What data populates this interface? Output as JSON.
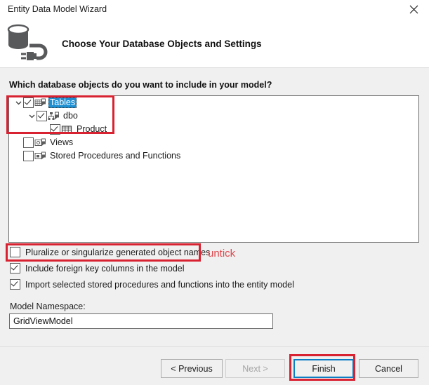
{
  "window": {
    "title": "Entity Data Model Wizard",
    "close_icon": "close-icon"
  },
  "header": {
    "icon": "database-connection-icon",
    "title": "Choose Your Database Objects and Settings"
  },
  "main": {
    "question": "Which database objects do you want to include in your model?",
    "tree": [
      {
        "label": "Tables",
        "checked": true,
        "expanded": true,
        "selected": true,
        "indent": 0,
        "icon": "tables-folder-icon"
      },
      {
        "label": "dbo",
        "checked": true,
        "expanded": true,
        "selected": false,
        "indent": 1,
        "icon": "schema-icon"
      },
      {
        "label": "Product",
        "checked": true,
        "expanded": null,
        "selected": false,
        "indent": 2,
        "icon": "table-grid-icon"
      },
      {
        "label": "Views",
        "checked": false,
        "expanded": null,
        "selected": false,
        "indent": 0,
        "icon": "views-folder-icon"
      },
      {
        "label": "Stored Procedures and Functions",
        "checked": false,
        "expanded": null,
        "selected": false,
        "indent": 0,
        "icon": "stored-procedures-folder-icon"
      }
    ],
    "options": [
      {
        "label": "Pluralize or singularize generated object names",
        "checked": false
      },
      {
        "label": "Include foreign key columns in the model",
        "checked": true
      },
      {
        "label": "Import selected stored procedures and functions into the entity model",
        "checked": true
      }
    ],
    "namespace": {
      "label": "Model Namespace:",
      "value": "GridViewModel",
      "placeholder": ""
    }
  },
  "footer": {
    "previous_label": "< Previous",
    "next_label": "Next >",
    "finish_label": "Finish",
    "cancel_label": "Cancel"
  },
  "annotations": {
    "untick_text": "untick",
    "color": "#d92231"
  }
}
